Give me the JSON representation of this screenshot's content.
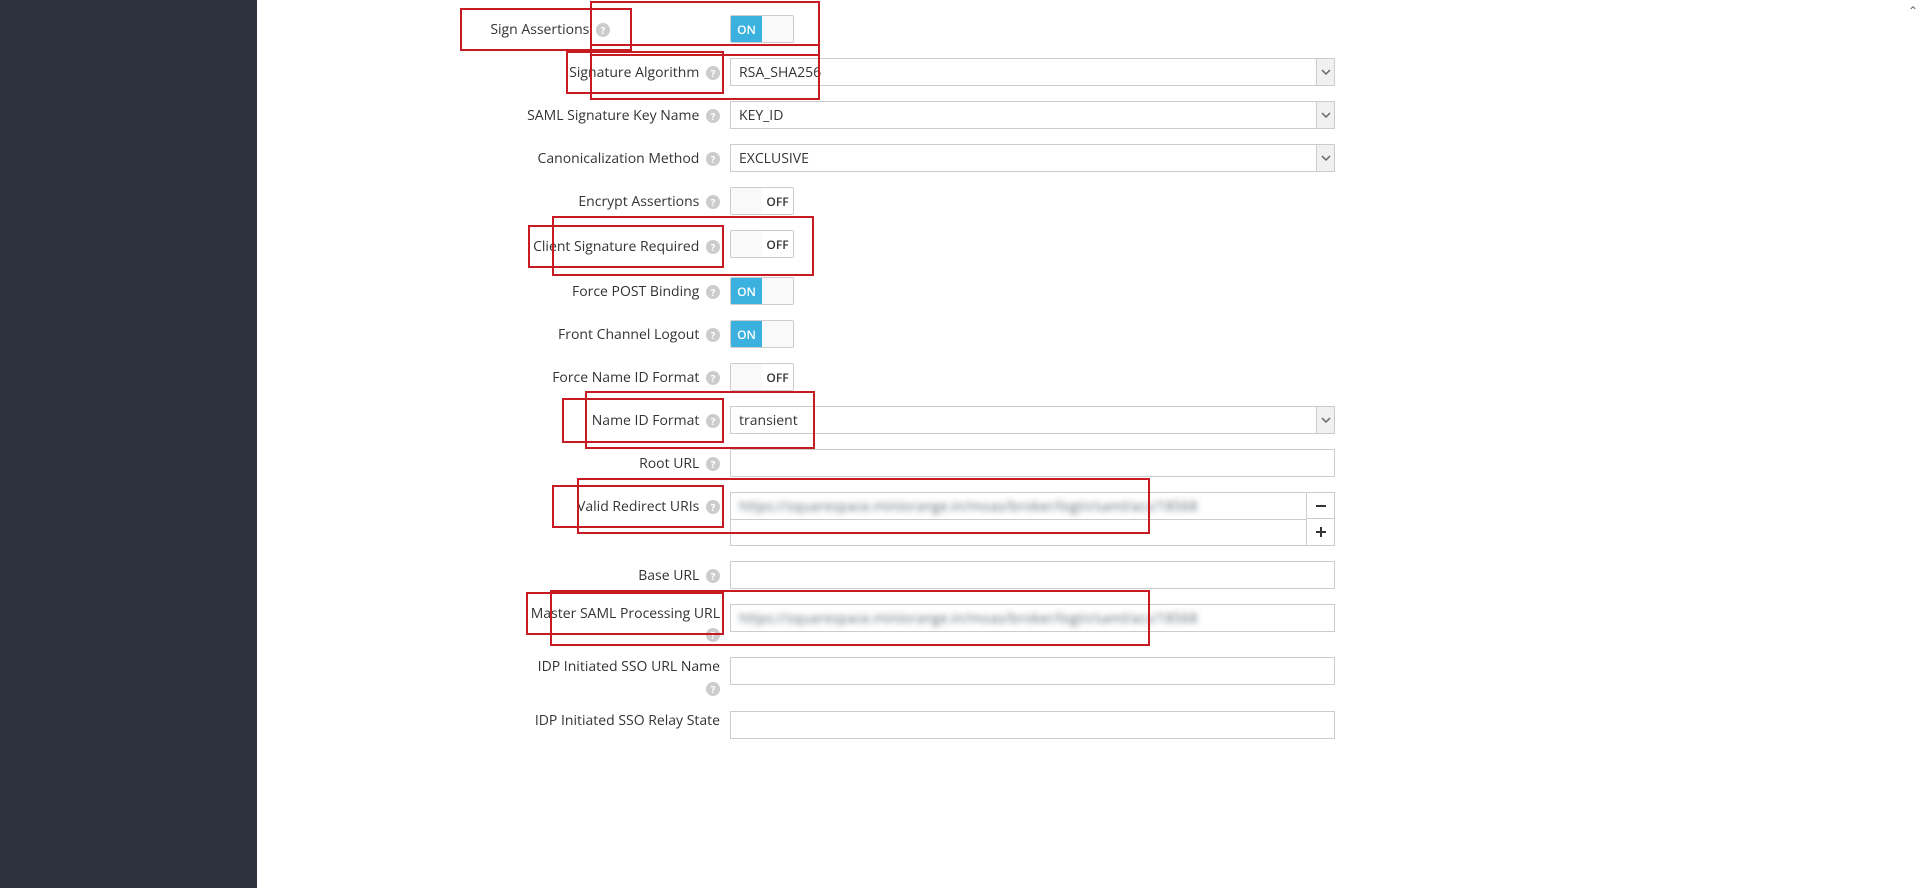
{
  "fields": {
    "signAssertions": {
      "label": "Sign Assertions",
      "state": "on"
    },
    "signatureAlgorithm": {
      "label": "Signature Algorithm",
      "value": "RSA_SHA256"
    },
    "samlSignatureKeyName": {
      "label": "SAML Signature Key Name",
      "value": "KEY_ID"
    },
    "canonicalizationMethod": {
      "label": "Canonicalization Method",
      "value": "EXCLUSIVE"
    },
    "encryptAssertions": {
      "label": "Encrypt Assertions",
      "state": "off"
    },
    "clientSignatureRequired": {
      "label": "Client Signature Required",
      "state": "off"
    },
    "forcePostBinding": {
      "label": "Force POST Binding",
      "state": "on"
    },
    "frontChannelLogout": {
      "label": "Front Channel Logout",
      "state": "on"
    },
    "forceNameIdFormat": {
      "label": "Force Name ID Format",
      "state": "off"
    },
    "nameIdFormat": {
      "label": "Name ID Format",
      "value": "transient"
    },
    "rootUrl": {
      "label": "Root URL",
      "value": ""
    },
    "validRedirectUris": {
      "label": "Valid Redirect URIs",
      "value": "https://squarespace.miniorange.in/moas/broker/login/saml/acs/18568"
    },
    "baseUrl": {
      "label": "Base URL",
      "value": ""
    },
    "masterSamlProcessingUrl": {
      "label": "Master SAML Processing URL",
      "value": "https://squarespace.miniorange.in/moas/broker/login/saml/acs/18568"
    },
    "idpInitiatedSsoUrlName": {
      "label": "IDP Initiated SSO URL Name",
      "value": ""
    },
    "idpInitiatedSsoRelayState": {
      "label": "IDP Initiated SSO Relay State",
      "value": ""
    }
  },
  "toggleText": {
    "on": "ON",
    "off": "OFF"
  },
  "icons": {
    "help": "?"
  }
}
